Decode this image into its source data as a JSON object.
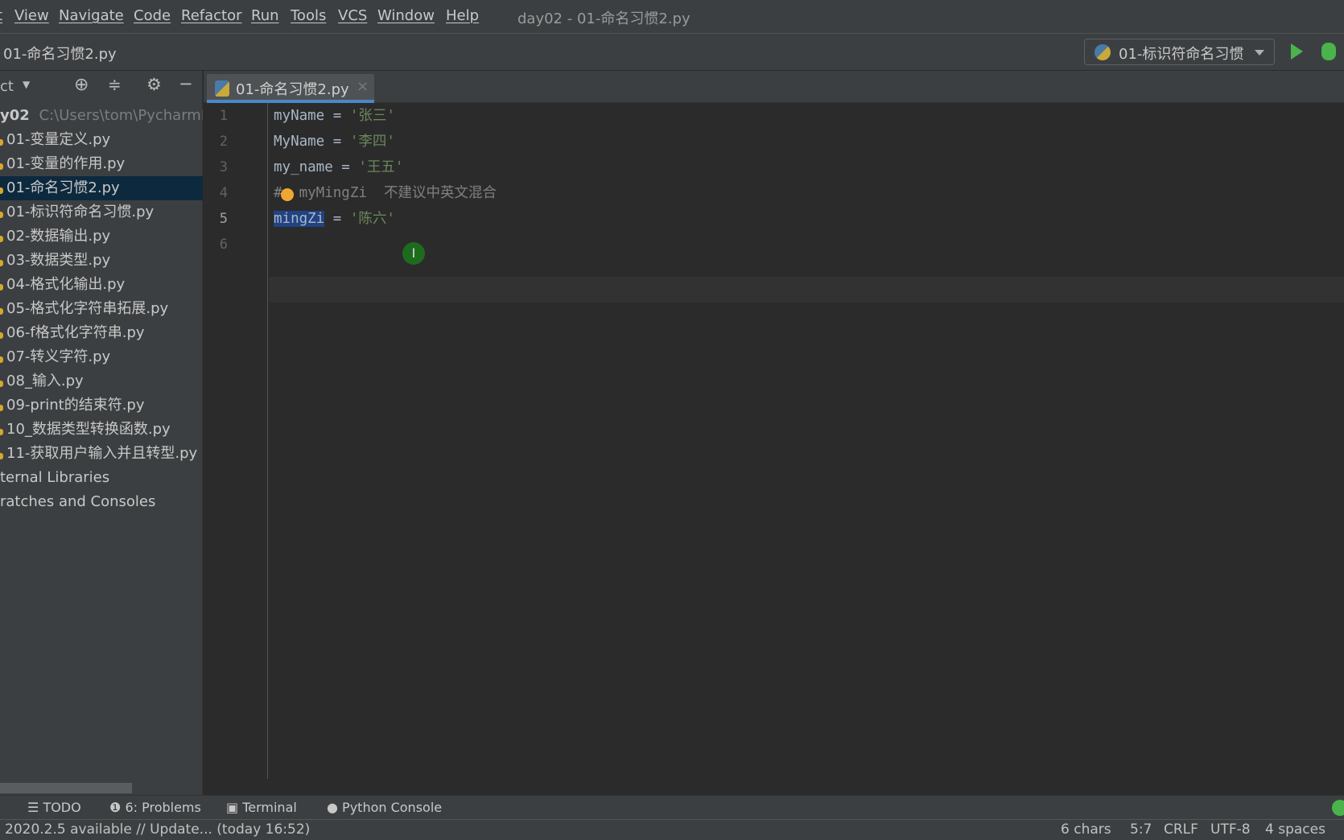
{
  "menu": {
    "items": [
      "t",
      "View",
      "Navigate",
      "Code",
      "Refactor",
      "Run",
      "Tools",
      "VCS",
      "Window",
      "Help"
    ],
    "window_title": "day02 - 01-命名习惯2.py"
  },
  "navbar": {
    "breadcrumb": "01-命名习惯2.py",
    "run_config": "01-标识符命名习惯"
  },
  "sidebar": {
    "view_label": "ct",
    "project_name": "y02",
    "project_path": "C:\\Users\\tom\\PycharmPr",
    "files": [
      "01-变量定义.py",
      "01-变量的作用.py",
      "01-命名习惯2.py",
      "01-标识符命名习惯.py",
      "02-数据输出.py",
      "03-数据类型.py",
      "04-格式化输出.py",
      "05-格式化字符串拓展.py",
      "06-f格式化字符串.py",
      "07-转义字符.py",
      "08_输入.py",
      "09-print的结束符.py",
      "10_数据类型转换函数.py",
      "11-获取用户输入并且转型.py"
    ],
    "selected": "01-命名习惯2.py",
    "extra": [
      "ternal Libraries",
      "ratches and Consoles"
    ]
  },
  "editor": {
    "tab": "01-命名习惯2.py",
    "line_numbers": [
      "1",
      "2",
      "3",
      "4",
      "5",
      "6"
    ],
    "current_line": "5",
    "lines": [
      {
        "name": "myName",
        "op": " = ",
        "str": "'张三'"
      },
      {
        "name": "MyName",
        "op": " = ",
        "str": "'李四'"
      },
      {
        "name": "my_name",
        "op": " = ",
        "str": "'王五'"
      },
      {
        "comment": "#  myMingZi  不建议中英文混合"
      },
      {
        "name": "mingZi",
        "op": " = ",
        "str": "'陈六'"
      }
    ]
  },
  "toolwindows": {
    "todo": "TODO",
    "problems": "6: Problems",
    "terminal": "Terminal",
    "python_console": "Python Console"
  },
  "status": {
    "update": "2020.2.5 available // Update... (today 16:52)",
    "chars": "6 chars",
    "position": "5:7",
    "line_sep": "CRLF",
    "encoding": "UTF-8",
    "indent": "4 spaces"
  },
  "colors": {
    "accent": "#4a88c7",
    "string": "#6a8759",
    "selection": "#214283",
    "run": "#4bb34b"
  }
}
